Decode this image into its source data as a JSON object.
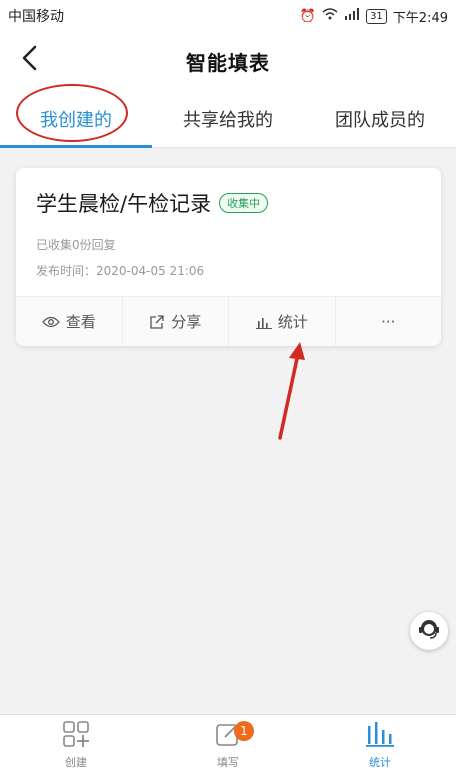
{
  "status": {
    "carrier": "中国移动",
    "battery": "31",
    "time": "下午2:49"
  },
  "header": {
    "title": "智能填表"
  },
  "tabs": [
    {
      "label": "我创建的"
    },
    {
      "label": "共享给我的"
    },
    {
      "label": "团队成员的"
    }
  ],
  "card": {
    "title": "学生晨检/午检记录",
    "badge": "收集中",
    "collected": "已收集0份回复",
    "published": "发布时间：2020-04-05 21:06",
    "actions": {
      "view": "查看",
      "share": "分享",
      "stats": "统计",
      "more": "···"
    }
  },
  "nav": {
    "create": "创建",
    "fill": "填写",
    "fill_badge": "1",
    "stats": "统计"
  },
  "colors": {
    "accent": "#2a8fd6",
    "annotation": "#d02a22",
    "badge_green": "#27a05a",
    "notif": "#f06a1b"
  },
  "icons": [
    "back-icon",
    "eye-icon",
    "share-icon",
    "bar-chart-icon",
    "more-icon",
    "support-icon",
    "create-icon",
    "fill-icon",
    "stats-icon"
  ]
}
